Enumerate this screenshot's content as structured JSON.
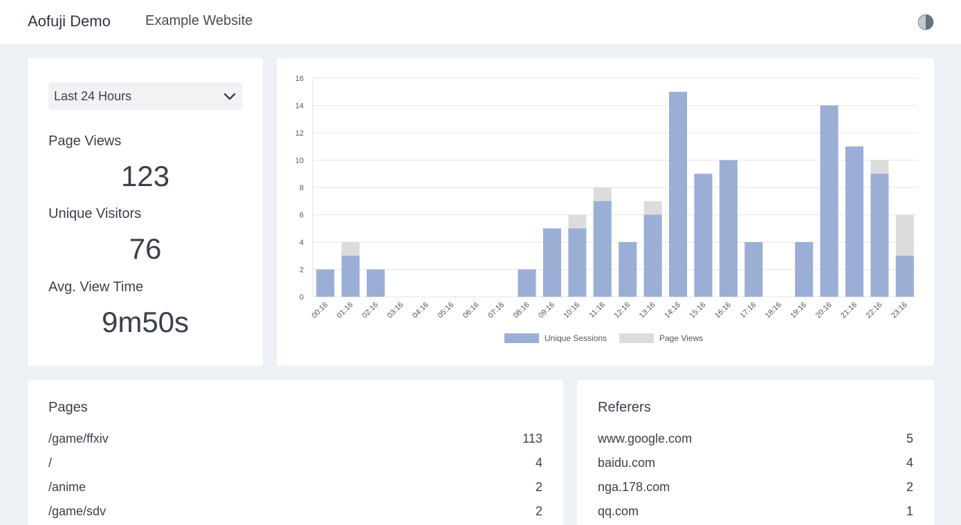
{
  "header": {
    "brand": "Aofuji Demo",
    "site": "Example Website",
    "theme_toggle_icon": "half-circle-contrast-icon"
  },
  "stats": {
    "range": {
      "selected": "Last 24 Hours",
      "icon": "chevron-down-icon"
    },
    "page_views": {
      "label": "Page Views",
      "value": "123"
    },
    "unique_visitors": {
      "label": "Unique Visitors",
      "value": "76"
    },
    "avg_view_time": {
      "label": "Avg. View Time",
      "value": "9m50s"
    }
  },
  "chart_data": {
    "type": "bar",
    "stacked": true,
    "categories": [
      "00:16",
      "01:16",
      "02:16",
      "03:16",
      "04:16",
      "05:16",
      "06:16",
      "07:16",
      "08:16",
      "09:16",
      "10:16",
      "11:16",
      "12:16",
      "13:16",
      "14:16",
      "15:16",
      "16:16",
      "17:16",
      "18:16",
      "19:16",
      "20:16",
      "21:16",
      "22:16",
      "23:16"
    ],
    "series": [
      {
        "name": "Unique Sessions",
        "color": "#9aaed6",
        "values": [
          2,
          3,
          2,
          0,
          0,
          0,
          0,
          0,
          2,
          5,
          5,
          7,
          4,
          6,
          15,
          9,
          10,
          4,
          0,
          4,
          14,
          11,
          9,
          3
        ]
      },
      {
        "name": "Page Views",
        "color": "#dcdcdc",
        "values": [
          2,
          4,
          2,
          0,
          0,
          0,
          0,
          0,
          2,
          5,
          6,
          8,
          4,
          7,
          15,
          9,
          10,
          4,
          0,
          4,
          14,
          11,
          10,
          6
        ]
      }
    ],
    "yticks": [
      0,
      2,
      4,
      6,
      8,
      10,
      12,
      14,
      16
    ],
    "ylim": [
      0,
      16
    ],
    "grid": true,
    "legend_position": "bottom"
  },
  "pages": {
    "title": "Pages",
    "rows": [
      {
        "key": "/game/ffxiv",
        "value": "113"
      },
      {
        "key": "/",
        "value": "4"
      },
      {
        "key": "/anime",
        "value": "2"
      },
      {
        "key": "/game/sdv",
        "value": "2"
      }
    ]
  },
  "referers": {
    "title": "Referers",
    "rows": [
      {
        "key": "www.google.com",
        "value": "5"
      },
      {
        "key": "baidu.com",
        "value": "4"
      },
      {
        "key": "nga.178.com",
        "value": "2"
      },
      {
        "key": "qq.com",
        "value": "1"
      }
    ]
  }
}
